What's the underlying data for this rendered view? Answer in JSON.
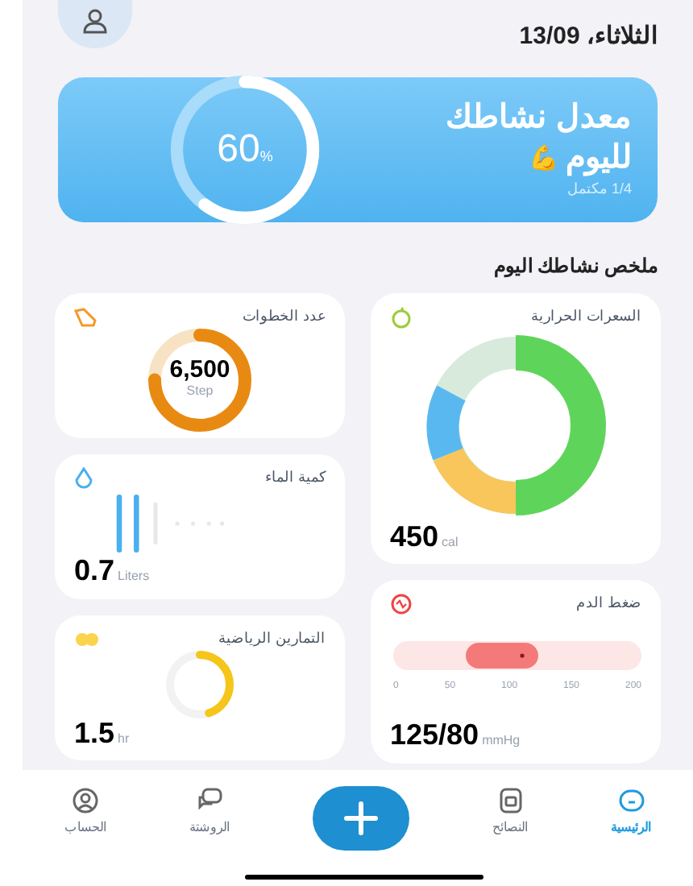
{
  "header": {
    "date": "الثلاثاء، 13/09"
  },
  "activity": {
    "title": "معدل نشاطك",
    "subtitle": "لليوم",
    "emoji": "💪",
    "progress": "1/4 مكتمل",
    "percent": "60",
    "percent_unit": "%"
  },
  "section_title": "ملخص نشاطك اليوم",
  "cards": [
    {
      "kind": "calories",
      "title": "السعرات الحرارية",
      "value": "450",
      "unit": "cal"
    },
    {
      "kind": "steps",
      "title": "عدد الخطوات",
      "value": "6,500",
      "unit": "Step"
    },
    {
      "kind": "water",
      "title": "كمية الماء",
      "value": "0.7",
      "unit": "Liters"
    },
    {
      "kind": "pressure",
      "title": "ضغط الدم",
      "value": "125/80",
      "unit": "mmHg",
      "ticks": [
        "200",
        "150",
        "100",
        "50",
        "0"
      ]
    },
    {
      "kind": "exercise",
      "title": "التمارين الرياضية",
      "value": "1.5",
      "unit": "hr"
    }
  ],
  "nav": [
    {
      "kind": "home",
      "label": "الرئيسية",
      "selected": true
    },
    {
      "kind": "tips",
      "label": "النصائح",
      "selected": false
    },
    {
      "kind": "add"
    },
    {
      "kind": "chat",
      "label": "الروشتة",
      "selected": false
    },
    {
      "kind": "account",
      "label": "الحساب",
      "selected": false
    }
  ]
}
